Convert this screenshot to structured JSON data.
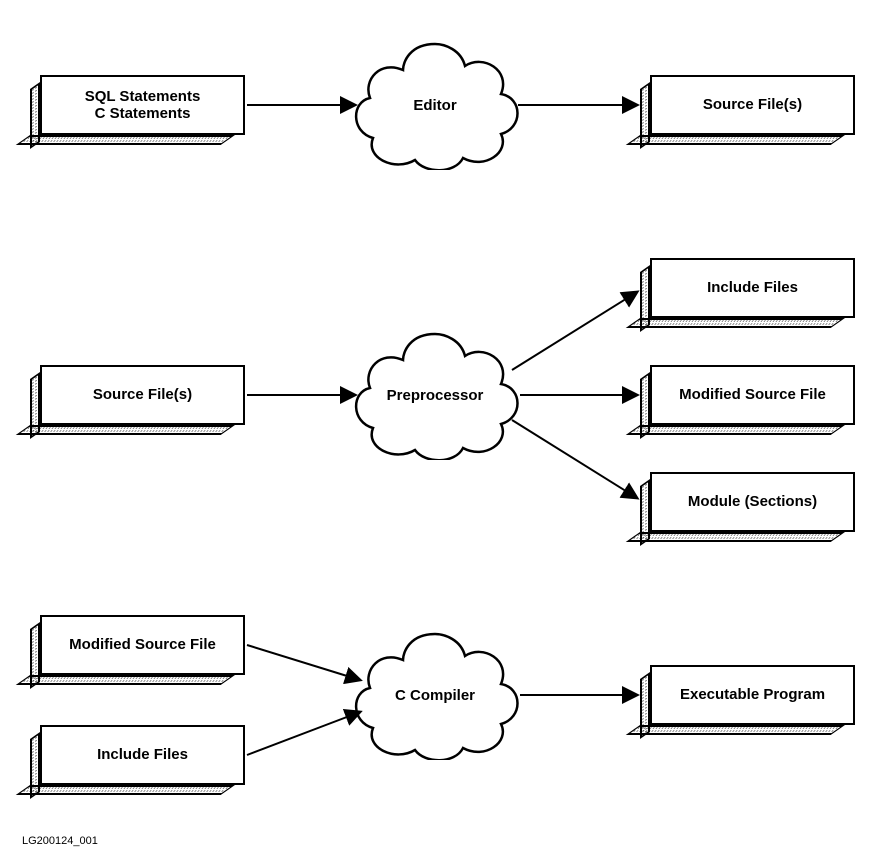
{
  "boxes": {
    "b1": "SQL Statements\nC Statements",
    "b2": "Source File(s)",
    "b3": "Source File(s)",
    "b4": "Include Files",
    "b5": "Modified Source File",
    "b6": "Module (Sections)",
    "b7": "Modified Source File",
    "b8": "Include Files",
    "b9": "Executable Program"
  },
  "clouds": {
    "c1": "Editor",
    "c2": "Preprocessor",
    "c3": "C Compiler"
  },
  "footer": "LG200124_001",
  "chart_data": {
    "type": "diagram",
    "title": "",
    "nodes": [
      {
        "id": "b1",
        "kind": "data",
        "label": "SQL Statements / C Statements"
      },
      {
        "id": "c1",
        "kind": "process",
        "label": "Editor"
      },
      {
        "id": "b2",
        "kind": "data",
        "label": "Source File(s)"
      },
      {
        "id": "b3",
        "kind": "data",
        "label": "Source File(s)"
      },
      {
        "id": "c2",
        "kind": "process",
        "label": "Preprocessor"
      },
      {
        "id": "b4",
        "kind": "data",
        "label": "Include Files"
      },
      {
        "id": "b5",
        "kind": "data",
        "label": "Modified Source File"
      },
      {
        "id": "b6",
        "kind": "data",
        "label": "Module (Sections)"
      },
      {
        "id": "b7",
        "kind": "data",
        "label": "Modified Source File"
      },
      {
        "id": "b8",
        "kind": "data",
        "label": "Include Files"
      },
      {
        "id": "c3",
        "kind": "process",
        "label": "C Compiler"
      },
      {
        "id": "b9",
        "kind": "data",
        "label": "Executable Program"
      }
    ],
    "edges": [
      {
        "from": "b1",
        "to": "c1"
      },
      {
        "from": "c1",
        "to": "b2"
      },
      {
        "from": "b3",
        "to": "c2"
      },
      {
        "from": "c2",
        "to": "b4"
      },
      {
        "from": "c2",
        "to": "b5"
      },
      {
        "from": "c2",
        "to": "b6"
      },
      {
        "from": "b7",
        "to": "c3"
      },
      {
        "from": "b8",
        "to": "c3"
      },
      {
        "from": "c3",
        "to": "b9"
      }
    ]
  }
}
